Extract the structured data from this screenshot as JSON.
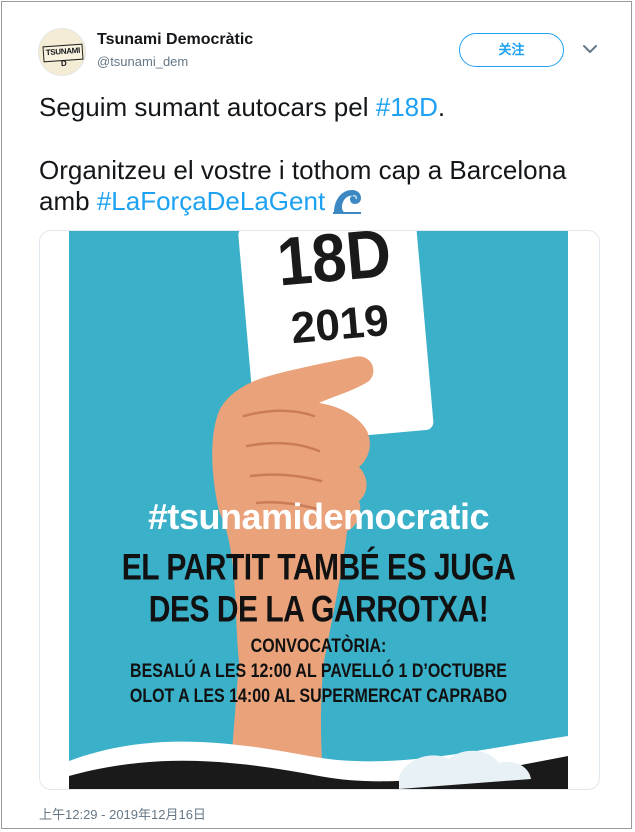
{
  "author": {
    "display_name": "Tsunami Democràtic",
    "handle": "@tsunami_dem",
    "avatar_text": "TSUNAMI D"
  },
  "follow_label": "关注",
  "tweet": {
    "line1_prefix": "Seguim sumant autocars pel ",
    "line1_hashtag": "#18D",
    "line1_suffix": ".",
    "line2_prefix": "Organitzeu el vostre i tothom cap a Barcelona amb ",
    "line2_hashtag": "#LaForçaDeLaGent",
    "emoji_icon": "water-wave-icon"
  },
  "poster": {
    "card_line1": "18D",
    "card_line2": "2019",
    "hashtag": "#tsunamidemocratic",
    "headline1": "EL PARTIT TAMBÉ ES JUGA",
    "headline2": "DES DE LA GARROTXA!",
    "sub1": "CONVOCATÒRIA:",
    "sub2": "BESALÚ A LES 12:00 AL PAVELLÓ 1 D’OCTUBRE",
    "sub3": "OLOT A LES 14:00 AL SUPERMERCAT CAPRABO",
    "colors": {
      "background": "#3ab0c9",
      "text_light": "#ffffff",
      "text_dark": "#111111"
    }
  },
  "timestamp": "上午12:29 - 2019年12月16日",
  "colors": {
    "link": "#1da1f2",
    "muted": "#657786",
    "text": "#14171a"
  }
}
